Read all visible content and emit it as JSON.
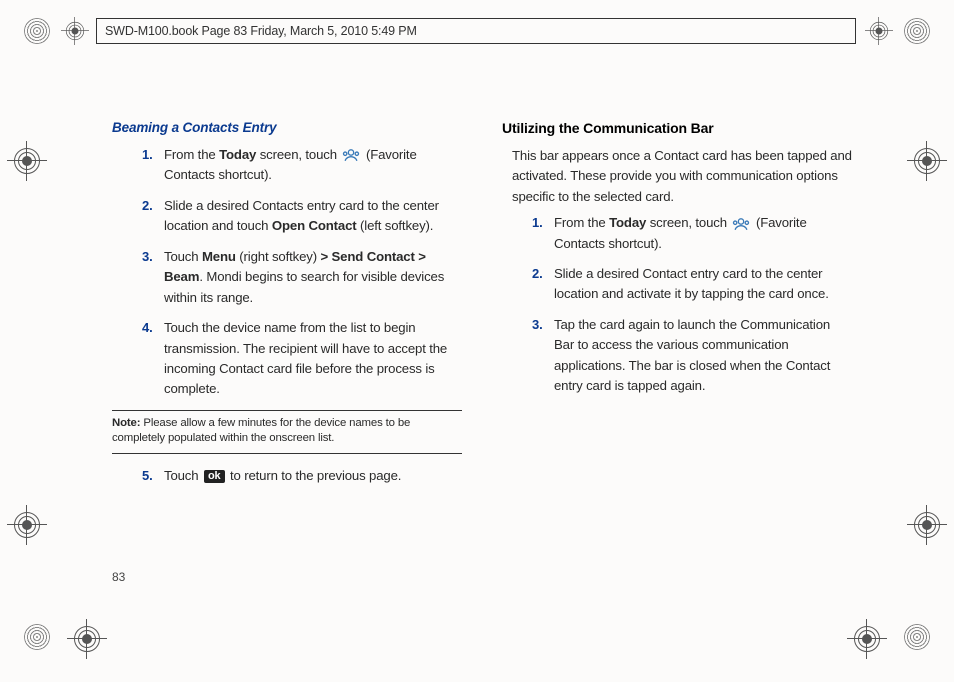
{
  "header": {
    "text": "SWD-M100.book  Page 83  Friday, March 5, 2010  5:49 PM"
  },
  "page_number": "83",
  "left": {
    "title": "Beaming a Contacts Entry",
    "steps": {
      "s1": {
        "num": "1.",
        "p1": "From the ",
        "b1": "Today",
        "p2": " screen, touch ",
        "p3": " (Favorite Contacts shortcut)."
      },
      "s2": {
        "num": "2.",
        "p1": "Slide a desired Contacts entry card to the center location and touch ",
        "b1": "Open Contact",
        "p2": " (left softkey)."
      },
      "s3": {
        "num": "3.",
        "p1": "Touch ",
        "b1": "Menu",
        "p2": " (right softkey) ",
        "b2": "> Send Contact > Beam",
        "p3": ". Mondi begins to search for visible devices within its range."
      },
      "s4": {
        "num": "4.",
        "text": "Touch the device name from the list to begin transmission. The recipient will have to accept the incoming Contact card file before the process is complete."
      },
      "s5": {
        "num": "5.",
        "p1": "Touch ",
        "ok": "ok",
        "p2": " to return to the previous page."
      }
    },
    "note": {
      "label": "Note:",
      "text": " Please allow a few minutes for the device names to be completely populated within the onscreen list."
    }
  },
  "right": {
    "title": "Utilizing the Communication Bar",
    "intro": "This bar appears once a Contact card has been tapped and activated. These provide you with communication options specific to the selected card.",
    "steps": {
      "s1": {
        "num": "1.",
        "p1": "From the ",
        "b1": "Today",
        "p2": " screen, touch ",
        "p3": " (Favorite Contacts shortcut)."
      },
      "s2": {
        "num": "2.",
        "text": "Slide a desired Contact entry card to the center location and activate it by tapping the card once."
      },
      "s3": {
        "num": "3.",
        "text": "Tap the card again to launch the Communication Bar to access the various communication applications. The bar is closed when the Contact entry card is tapped again."
      }
    }
  }
}
